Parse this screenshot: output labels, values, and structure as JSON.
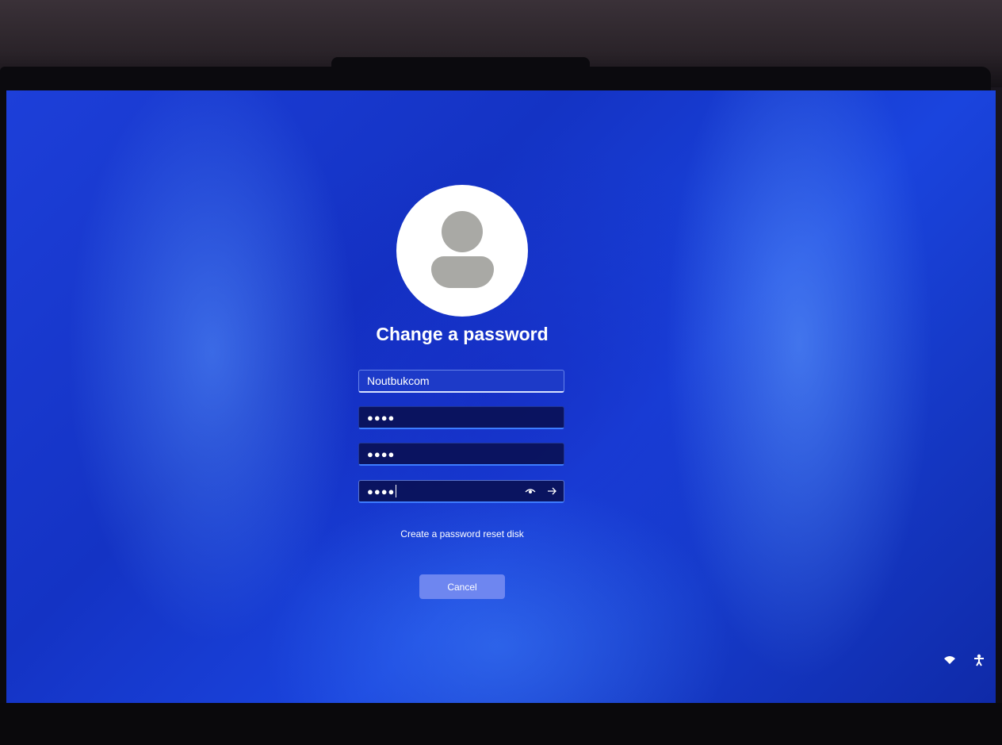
{
  "dialog": {
    "title": "Change a password",
    "username_value": "Noutbukcom",
    "old_password_mask": "●●●●",
    "new_password_mask": "●●●●",
    "confirm_password_mask": "●●●●",
    "reset_disk_link": "Create a password reset disk",
    "cancel_label": "Cancel"
  },
  "icons": {
    "avatar": "user-avatar-icon",
    "reveal": "eye-icon",
    "submit": "arrow-right-icon",
    "network": "wifi-icon",
    "accessibility": "accessibility-icon"
  },
  "colors": {
    "background": "#1a44de",
    "cancel_button": "#6e86f0",
    "field_underline": "#3d7cff"
  }
}
